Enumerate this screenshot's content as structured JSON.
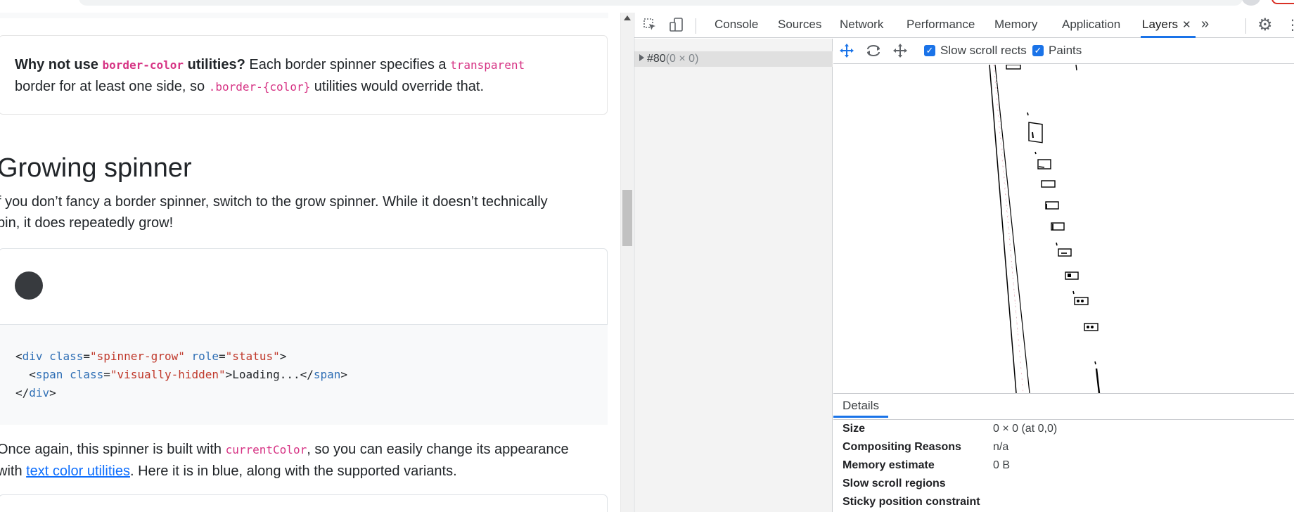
{
  "page": {
    "callout": {
      "q_bold": "Why not use ",
      "q_code": "border-color",
      "q_bold2": " utilities?",
      "text1": " Each border spinner specifies a ",
      "code2": "transparent",
      "text2": "border for at least one side, so ",
      "code3": ".border-{color}",
      "text3": " utilities would override that."
    },
    "heading": "Growing spinner",
    "para_line1": "f you don’t fancy a border spinner, switch to the grow spinner. While it doesn’t technically",
    "para_line2": "pin, it does repeatedly grow!",
    "code": {
      "l1_open": "<",
      "l1_tag": "div",
      "l1_attr1": " class",
      "l1_eq1": "=",
      "l1_val1": "\"spinner-grow\"",
      "l1_attr2": " role",
      "l1_eq2": "=",
      "l1_val2": "\"status\"",
      "l1_close": ">",
      "l2_indent": "  <",
      "l2_tag": "span",
      "l2_attr": " class",
      "l2_eq": "=",
      "l2_val": "\"visually-hidden\"",
      "l2_mid": ">Loading...</",
      "l2_tag2": "span",
      "l2_close": ">",
      "l3_open": "</",
      "l3_tag": "div",
      "l3_close": ">"
    },
    "para2_a": "Once again, this spinner is built with ",
    "para2_code": "currentColor",
    "para2_b": ", so you can easily change its appearance",
    "para2_c": "with ",
    "para2_link": "text color utilities",
    "para2_d": ". Here it is in blue, along with the supported variants."
  },
  "devtools": {
    "tabs": [
      "Console",
      "Sources",
      "Network",
      "Performance",
      "Memory",
      "Application",
      "Layers"
    ],
    "active_tab": "Layers",
    "more_label": "»",
    "tree": {
      "node_id": "#80",
      "node_dims": "(0 × 0)"
    },
    "layers_toolbar": {
      "pan_icon": "pan-mode-icon",
      "rotate_icon": "rotate-mode-icon",
      "reset_icon": "reset-transform-icon",
      "slow_scroll_label": "Slow scroll rects",
      "slow_scroll_checked": true,
      "paints_label": "Paints",
      "paints_checked": true
    },
    "details": {
      "tab": "Details",
      "rows": [
        {
          "key": "Size",
          "value": "0 × 0 (at 0,0)"
        },
        {
          "key": "Compositing Reasons",
          "value": "n/a"
        },
        {
          "key": "Memory estimate",
          "value": "0 B"
        },
        {
          "key": "Slow scroll regions",
          "value": ""
        },
        {
          "key": "Sticky position constraint",
          "value": ""
        }
      ]
    }
  },
  "colors": {
    "accent": "#1a73e8",
    "code_pink": "#d63384",
    "link": "#0d6efd",
    "spinner": "#212529"
  }
}
